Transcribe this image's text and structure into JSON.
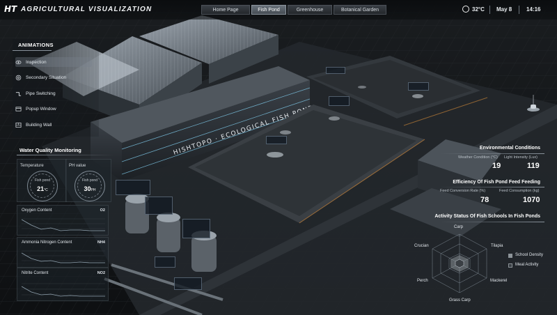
{
  "header": {
    "logo": "HT",
    "title": "AGRICULTURAL VISUALIZATION",
    "tabs": [
      {
        "label": "Home Page",
        "active": false
      },
      {
        "label": "Fish Pond",
        "active": true
      },
      {
        "label": "Greenhouse",
        "active": false
      },
      {
        "label": "Botanical Garden",
        "active": false
      }
    ],
    "temperature": "32°C",
    "date": "May 8",
    "time": "14:16"
  },
  "animations": {
    "title": "ANIMATIONS",
    "items": [
      {
        "label": "Inspection",
        "icon": "eye-icon",
        "active": true
      },
      {
        "label": "Secondary Situation",
        "icon": "target-icon",
        "active": false
      },
      {
        "label": "Pipe Switching",
        "icon": "pipe-icon",
        "active": false
      },
      {
        "label": "Popup Window",
        "icon": "window-icon",
        "active": false
      },
      {
        "label": "Building Wall",
        "icon": "wall-icon",
        "active": false
      }
    ]
  },
  "water_quality": {
    "title": "Water Quality Monitoring",
    "temperature": {
      "label": "Temperature",
      "gauge_label": "Fish pond",
      "value": "21",
      "unit": "°C"
    },
    "ph": {
      "label": "PH value",
      "gauge_label": "Fish pond",
      "value": "30",
      "unit": "PH"
    },
    "oxygen": {
      "title": "Oxygen Content",
      "unit": "O2"
    },
    "ammonia": {
      "title": "Ammonia Nitrogen Content",
      "unit": "NH4"
    },
    "nitrite": {
      "title": "Nitrite Content",
      "unit": "NO2"
    }
  },
  "environment": {
    "title": "Environmental Conditions",
    "weather_label": "Weather Condition (°C)",
    "weather_value": "19",
    "light_label": "Light Intensity (Lux)",
    "light_value": "119"
  },
  "feeding": {
    "title": "Efficiency Of Fish Pond Feed Feeding",
    "fcr_label": "Feed Conversion Rate (%)",
    "fcr_value": "78",
    "consumption_label": "Feed Consumption (kg)",
    "consumption_value": "1070"
  },
  "activity": {
    "title": "Activity Status Of Fish Schools In Fish Ponds",
    "axes": [
      "Carp",
      "Tilapia",
      "Mackerel",
      "Grass Carp",
      "Perch",
      "Crucian"
    ],
    "legend": [
      {
        "name": "School Density",
        "color": "#8c9398"
      },
      {
        "name": "Meal Activity",
        "color": "#3a3f44"
      }
    ]
  },
  "scene": {
    "building_sign": "HISHTOPO · ECOLOGICAL FISH POND"
  }
}
